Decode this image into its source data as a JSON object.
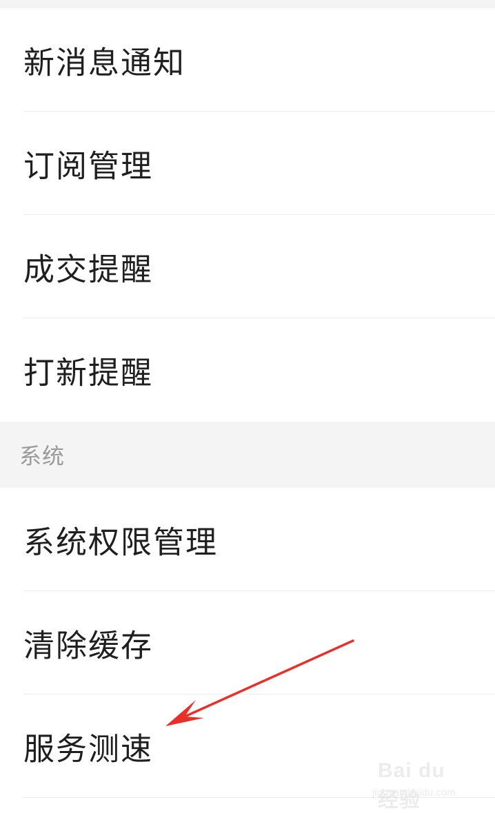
{
  "notifications_list": {
    "items": [
      {
        "label": "新消息通知"
      },
      {
        "label": "订阅管理"
      },
      {
        "label": "成交提醒"
      },
      {
        "label": "打新提醒"
      }
    ]
  },
  "system_section": {
    "title": "系统",
    "items": [
      {
        "label": "系统权限管理"
      },
      {
        "label": "清除缓存"
      },
      {
        "label": "服务测速"
      }
    ]
  },
  "annotation": {
    "arrow_color": "#e8302a",
    "points_to": "服务测速"
  },
  "watermark": {
    "logo_text": "Bai du 经验",
    "url_text": "jingyan.baidu.com"
  },
  "colors": {
    "background": "#ffffff",
    "section_background": "#f4f4f4",
    "text_primary": "#1f1f1f",
    "text_section": "#9a9a9a",
    "divider": "#ececec"
  }
}
